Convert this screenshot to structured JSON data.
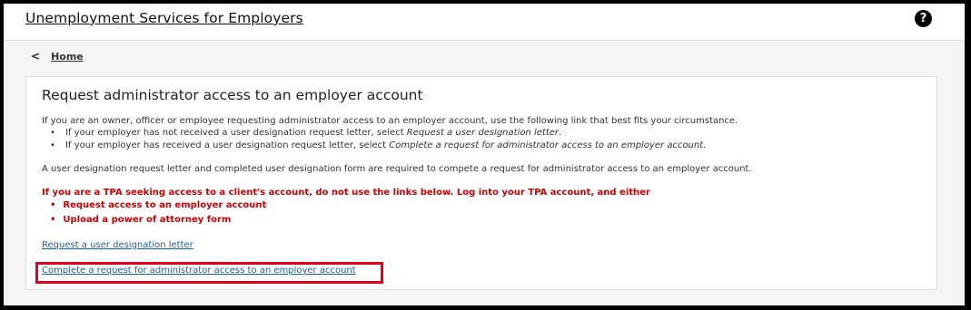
{
  "header": {
    "title": "Unemployment Services for Employers",
    "help_icon": "question-circle-icon",
    "help_glyph": "?"
  },
  "breadcrumb": {
    "chevron_glyph": "<",
    "home_label": "Home"
  },
  "card": {
    "title": "Request administrator access to an employer account",
    "intro": "If you are an owner, officer or employee requesting administrator access to an employer account, use the following link that best fits your circumstance.",
    "options": [
      {
        "prefix": "If your employer has not received a user designation request letter, select ",
        "emphasis": "Request a user designation letter",
        "suffix": "."
      },
      {
        "prefix": "If your employer has received a user designation request letter, select ",
        "emphasis": "Complete a request for administrator access to an employer account",
        "suffix": "."
      }
    ],
    "requirement": "A user designation request letter and completed user designation form are required to compete a request for administrator access to an employer account.",
    "warning": "If you are a TPA seeking access to a client's account, do not use the links below. Log into your TPA account, and either",
    "warning_items": [
      "Request access to an employer account",
      "Upload a power of attorney form"
    ],
    "links": {
      "request_letter": "Request a user designation letter",
      "complete_request": "Complete a request for administrator access to an employer account"
    }
  },
  "colors": {
    "link": "#1a5fa8",
    "warning": "#cc0000",
    "highlight_box": "#e0001b"
  }
}
